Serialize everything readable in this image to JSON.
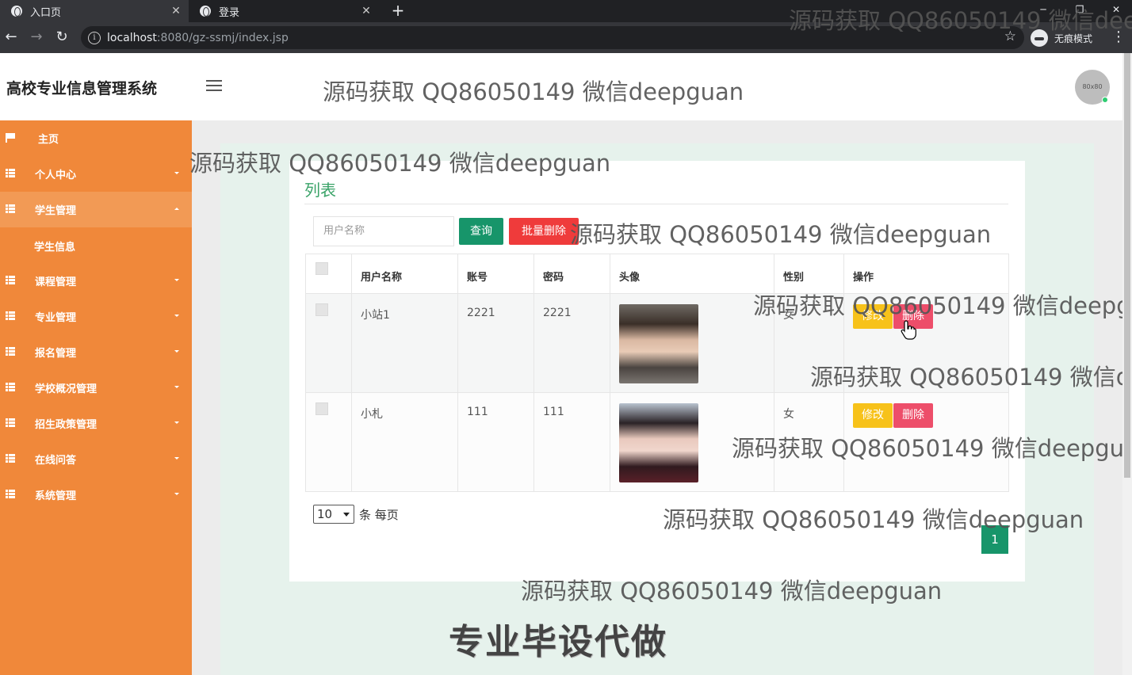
{
  "browser": {
    "tabs": [
      {
        "label": "入口页",
        "active": true
      },
      {
        "label": "登录",
        "active": false
      }
    ],
    "new_tab": "+",
    "url_host": "localhost",
    "url_path": ":8080/gz-ssmj/index.jsp",
    "incognito_label": "无痕模式"
  },
  "app": {
    "title": "高校专业信息管理系统",
    "avatar_text": "80x80"
  },
  "sidebar": {
    "items": [
      {
        "label": "主页",
        "icon": "flag-icon",
        "expanded": false
      },
      {
        "label": "个人中心",
        "icon": "grid-icon",
        "expanded": false
      },
      {
        "label": "学生管理",
        "icon": "grid-icon",
        "expanded": true
      },
      {
        "label": "课程管理",
        "icon": "grid-icon",
        "expanded": false
      },
      {
        "label": "专业管理",
        "icon": "grid-icon",
        "expanded": false
      },
      {
        "label": "报名管理",
        "icon": "grid-icon",
        "expanded": false
      },
      {
        "label": "学校概况管理",
        "icon": "grid-icon",
        "expanded": false
      },
      {
        "label": "招生政策管理",
        "icon": "grid-icon",
        "expanded": false
      },
      {
        "label": "在线问答",
        "icon": "grid-icon",
        "expanded": false
      },
      {
        "label": "系统管理",
        "icon": "grid-icon",
        "expanded": false
      }
    ],
    "sub_item": "学生信息"
  },
  "panel": {
    "title": "列表",
    "search_placeholder": "用户名称",
    "query_button": "查询",
    "batch_delete_button": "批量删除"
  },
  "table": {
    "headers": [
      "用户名称",
      "账号",
      "密码",
      "头像",
      "性别",
      "操作"
    ],
    "rows": [
      {
        "name": "小站1",
        "account": "2221",
        "password": "2221",
        "gender": "女"
      },
      {
        "name": "小札",
        "account": "111",
        "password": "111",
        "gender": "女"
      }
    ],
    "edit_label": "修改",
    "delete_label": "删除"
  },
  "pagination": {
    "page_size": "10",
    "page_size_unit": "条 每页",
    "current_page": "1"
  },
  "watermark": {
    "text": "源码获取 QQ86050149 微信deepguan",
    "big_text": "专业毕设代做"
  },
  "colors": {
    "sidebar": "#f0883a",
    "primary": "#17956a",
    "danger": "#ef3b3b",
    "warning": "#f7c21a"
  }
}
